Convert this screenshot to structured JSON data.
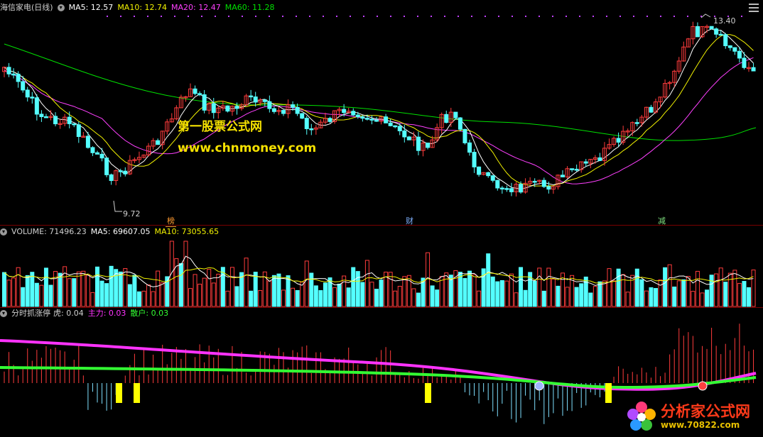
{
  "price_header": {
    "stock": "海信家电(日线)",
    "ma5": "MA5: 12.57",
    "ma10": "MA10: 12.74",
    "ma20": "MA20: 12.47",
    "ma60": "MA60: 11.28"
  },
  "volume_header": {
    "volume": "VOLUME: 71496.23",
    "ma5": "MA5: 69607.05",
    "ma10": "MA10: 73055.65"
  },
  "indicator_header": {
    "name": "分时抓涨停",
    "hu": "虎: 0.04",
    "main_force": "主力: 0.03",
    "retail": "散户: 0.03"
  },
  "price_labels": {
    "high": "13.40",
    "low": "9.72"
  },
  "event_flags": {
    "bang": "榜",
    "cai": "财",
    "jian": "减"
  },
  "watermark": {
    "line1": "第一股票公式网",
    "line2": "www.chnmoney.com"
  },
  "logo": {
    "name": "分析家公式网",
    "url": "www.70822.com"
  },
  "colors": {
    "up": "#ff3c3c",
    "down": "#54ffff",
    "ma5": "#ffffff",
    "ma10": "#f2f200",
    "ma20": "#ff40ff",
    "ma60": "#00e000",
    "main_force": "#ff33ff",
    "retail": "#33ff33"
  },
  "icons": {
    "collapse": "chevron-down-icon",
    "menu": "menu-lines-icon",
    "settings": "gear-icon"
  }
}
